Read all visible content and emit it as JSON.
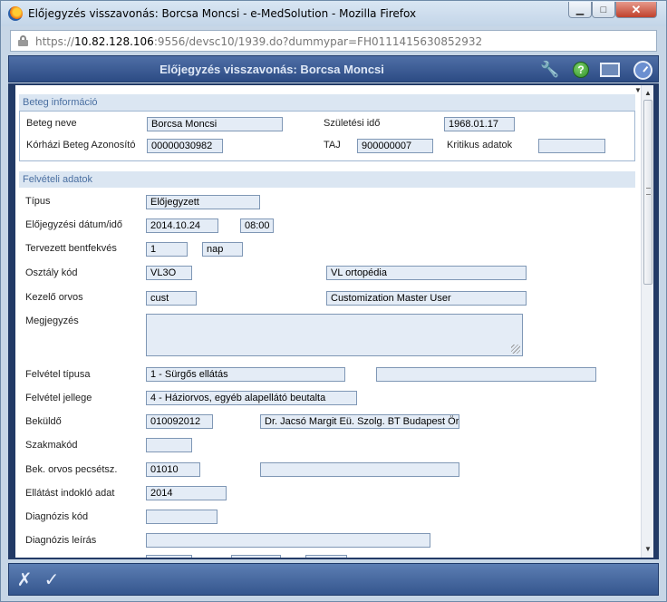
{
  "window": {
    "title": "Előjegyzés visszavonás: Borcsa Moncsi - e-MedSolution - Mozilla Firefox",
    "min_glyph": "▁",
    "max_glyph": "□",
    "close_glyph": "✕"
  },
  "url": {
    "scheme": "https://",
    "host": "10.82.128.106",
    "rest": ":9556/devsc10/1939.do?dummypar=FH0111415630852932"
  },
  "header": {
    "title": "Előjegyzés visszavonás: Borcsa Moncsi",
    "icons": [
      "wrench-icon",
      "help-icon",
      "screen-icon",
      "clock-icon"
    ],
    "help_glyph": "?"
  },
  "beteg": {
    "title": "Beteg információ",
    "nev_label": "Beteg neve",
    "nev_value": "Borcsa Moncsi",
    "szul_label": "Születési idő",
    "szul_value": "1968.01.17",
    "azon_label": "Kórházi Beteg Azonosító",
    "azon_value": "00000030982",
    "taj_label": "TAJ",
    "taj_value": "900000007",
    "kritikus_label": "Kritikus adatok",
    "kritikus_value": ""
  },
  "felveteli": {
    "title": "Felvételi adatok",
    "tipus_label": "Típus",
    "tipus_value": "Előjegyzett",
    "datum_label": "Előjegyzési dátum/idő",
    "datum_value": "2014.10.24",
    "ido_value": "08:00",
    "bentfekves_label": "Tervezett bentfekvés",
    "bentfekves_value": "1",
    "bentfekves_unit": "nap",
    "osztaly_label": "Osztály kód",
    "osztaly_kod": "VL3O",
    "osztaly_nev": "VL ortopédia",
    "orvos_label": "Kezelő orvos",
    "orvos_kod": "cust",
    "orvos_nev": "Customization Master User",
    "megjegyzes_label": "Megjegyzés",
    "megjegyzes_value": "",
    "felvetel_tipusa_label": "Felvétel típusa",
    "felvetel_tipusa_value": "1 - Sürgős ellátás",
    "felvetel_tipusa_extra": "",
    "felvetel_jellege_label": "Felvétel jellege",
    "felvetel_jellege_value": "4 - Háziorvos, egyéb alapellátó beutalta",
    "bekuldo_label": "Beküldő",
    "bekuldo_kod": "010092012",
    "bekuldo_nev": "Dr. Jacsó Margit Eü. Szolg. BT Budapest Örs",
    "szakmakod_label": "Szakmakód",
    "szakmakod_value": "",
    "pecsetsz_label": "Bek. orvos pecsétsz.",
    "pecsetsz_value": "01010",
    "pecsetsz_nev": "",
    "indoklo_label": "Ellátást indokló adat",
    "indoklo_value": "2014",
    "diag_kod_label": "Diagnózis kód",
    "diag_kod_value": "",
    "diag_leiras_label": "Diagnózis leírás",
    "diag_leiras_value": ""
  },
  "footer": {
    "cancel_glyph": "✗",
    "ok_glyph": "✓"
  }
}
